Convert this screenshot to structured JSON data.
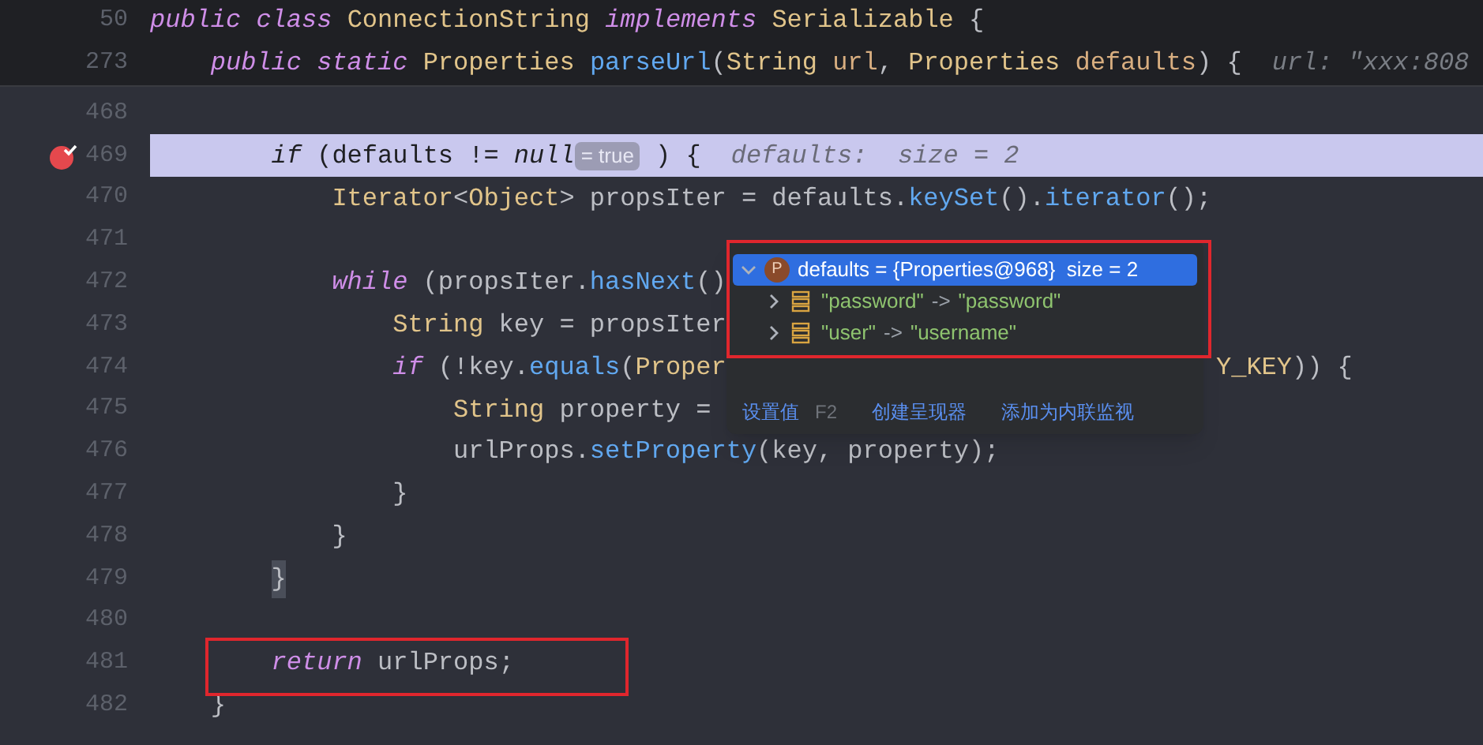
{
  "sticky_lines": [
    {
      "line_number": "50",
      "tokens": [
        {
          "kind": "keyword",
          "text": "public class "
        },
        {
          "kind": "type",
          "text": "ConnectionString "
        },
        {
          "kind": "keyword",
          "text": "implements "
        },
        {
          "kind": "type",
          "text": "Serializable "
        },
        {
          "kind": "plain",
          "text": "{"
        }
      ],
      "children": [
        {
          "line_number": "273",
          "tokens": [
            {
              "kind": "keyword",
              "text": "public static "
            },
            {
              "kind": "type",
              "text": "Properties "
            },
            {
              "kind": "method",
              "text": "parseUrl"
            },
            {
              "kind": "plain",
              "text": "("
            },
            {
              "kind": "type",
              "text": "String "
            },
            {
              "kind": "param",
              "text": "url"
            },
            {
              "kind": "plain",
              "text": ", "
            },
            {
              "kind": "type",
              "text": "Properties "
            },
            {
              "kind": "param",
              "text": "defaults"
            },
            {
              "kind": "plain",
              "text": ") {"
            },
            {
              "kind": "hint",
              "text": "url: \"xxx:808"
            }
          ]
        }
      ]
    }
  ],
  "lines": [
    {
      "kind": "block",
      "children": [
        {
          "kind": "line",
          "line_number": "468",
          "highlighted": false,
          "breakpoint": false
        },
        {
          "kind": "line",
          "line_number": "469",
          "highlighted": true,
          "breakpoint": true,
          "tokens": [
            {
              "kind": "keyword",
              "text": "if"
            },
            {
              "kind": "plain",
              "text": " (defaults != "
            },
            {
              "kind": "keyword",
              "text": "null"
            },
            {
              "kind": "chip",
              "text": "= true"
            },
            {
              "kind": "plain",
              "text": " ) {"
            },
            {
              "kind": "hint",
              "text": "defaults:  size = 2"
            }
          ],
          "children": [
            {
              "kind": "line",
              "line_number": "470",
              "highlighted": false,
              "breakpoint": false,
              "tokens": [
                {
                  "kind": "type",
                  "text": "Iterator"
                },
                {
                  "kind": "plain",
                  "text": "<"
                },
                {
                  "kind": "type",
                  "text": "Object"
                },
                {
                  "kind": "plain",
                  "text": "> propsIter = defaults."
                },
                {
                  "kind": "method",
                  "text": "keySet"
                },
                {
                  "kind": "plain",
                  "text": "()."
                },
                {
                  "kind": "method",
                  "text": "iterator"
                },
                {
                  "kind": "plain",
                  "text": "();"
                }
              ]
            },
            {
              "kind": "line",
              "line_number": "471",
              "highlighted": false,
              "breakpoint": false
            },
            {
              "kind": "line",
              "line_number": "472",
              "highlighted": false,
              "breakpoint": false,
              "tokens": [
                {
                  "kind": "keyword",
                  "text": "while"
                },
                {
                  "kind": "plain",
                  "text": " (propsIter."
                },
                {
                  "kind": "method",
                  "text": "hasNext"
                },
                {
                  "kind": "plain",
                  "text": "()"
                }
              ],
              "children": [
                {
                  "kind": "line",
                  "line_number": "473",
                  "highlighted": false,
                  "breakpoint": false,
                  "tokens": [
                    {
                      "kind": "type",
                      "text": "String"
                    },
                    {
                      "kind": "plain",
                      "text": " key = propsIter"
                    }
                  ]
                },
                {
                  "kind": "line",
                  "line_number": "474",
                  "highlighted": false,
                  "breakpoint": false,
                  "tokens": [
                    {
                      "kind": "keyword",
                      "text": "if"
                    },
                    {
                      "kind": "plain",
                      "text": " (!key."
                    },
                    {
                      "kind": "method",
                      "text": "equals"
                    },
                    {
                      "kind": "plain",
                      "text": "("
                    },
                    {
                      "kind": "type",
                      "text": "Proper"
                    }
                  ],
                  "tail_tokens": [
                    {
                      "kind": "type",
                      "text": "Y_KEY"
                    },
                    {
                      "kind": "plain",
                      "text": ")) {"
                    }
                  ],
                  "children": [
                    {
                      "kind": "line",
                      "line_number": "475",
                      "highlighted": false,
                      "breakpoint": false,
                      "tokens": [
                        {
                          "kind": "type",
                          "text": "String"
                        },
                        {
                          "kind": "plain",
                          "text": " property ="
                        }
                      ]
                    },
                    {
                      "kind": "line",
                      "line_number": "476",
                      "highlighted": false,
                      "breakpoint": false,
                      "tokens": [
                        {
                          "kind": "plain",
                          "text": "urlProps."
                        },
                        {
                          "kind": "method",
                          "text": "setProperty"
                        },
                        {
                          "kind": "plain",
                          "text": "(key, property);"
                        }
                      ]
                    }
                  ]
                },
                {
                  "kind": "line",
                  "line_number": "477",
                  "highlighted": false,
                  "breakpoint": false,
                  "tokens": [
                    {
                      "kind": "plain",
                      "text": "}"
                    }
                  ]
                }
              ]
            },
            {
              "kind": "line",
              "line_number": "478",
              "highlighted": false,
              "breakpoint": false,
              "tokens": [
                {
                  "kind": "plain",
                  "text": "}"
                }
              ]
            }
          ]
        },
        {
          "kind": "line",
          "line_number": "479",
          "highlighted": false,
          "breakpoint": false,
          "tokens": [
            {
              "kind": "brace_match",
              "text": "}"
            }
          ]
        },
        {
          "kind": "line",
          "line_number": "480",
          "highlighted": false,
          "breakpoint": false
        },
        {
          "kind": "line",
          "line_number": "481",
          "highlighted": false,
          "breakpoint": false,
          "tokens": [
            {
              "kind": "keyword",
              "text": "return"
            },
            {
              "kind": "plain",
              "text": " urlProps;"
            }
          ]
        }
      ]
    },
    {
      "kind": "line",
      "line_number": "482",
      "highlighted": false,
      "breakpoint": false,
      "tokens": [
        {
          "kind": "plain",
          "text": "}"
        }
      ]
    }
  ],
  "debug_popup": {
    "tree": [
      {
        "label": "defaults = {Properties@968}  size = 2",
        "badge": "P",
        "kind": "object",
        "expanded": true,
        "selected": true,
        "children": [
          {
            "key": "\"password\"",
            "arrow": "->",
            "value": "\"password\"",
            "kind": "entry",
            "expanded": false,
            "selected": false
          },
          {
            "key": "\"user\"",
            "arrow": "->",
            "value": "\"username\"",
            "kind": "entry",
            "expanded": false,
            "selected": false
          }
        ]
      }
    ],
    "actions": [
      {
        "label": "设置值",
        "shortcut": "F2"
      },
      {
        "label": "创建呈现器"
      },
      {
        "label": "添加为内联监视"
      }
    ]
  }
}
